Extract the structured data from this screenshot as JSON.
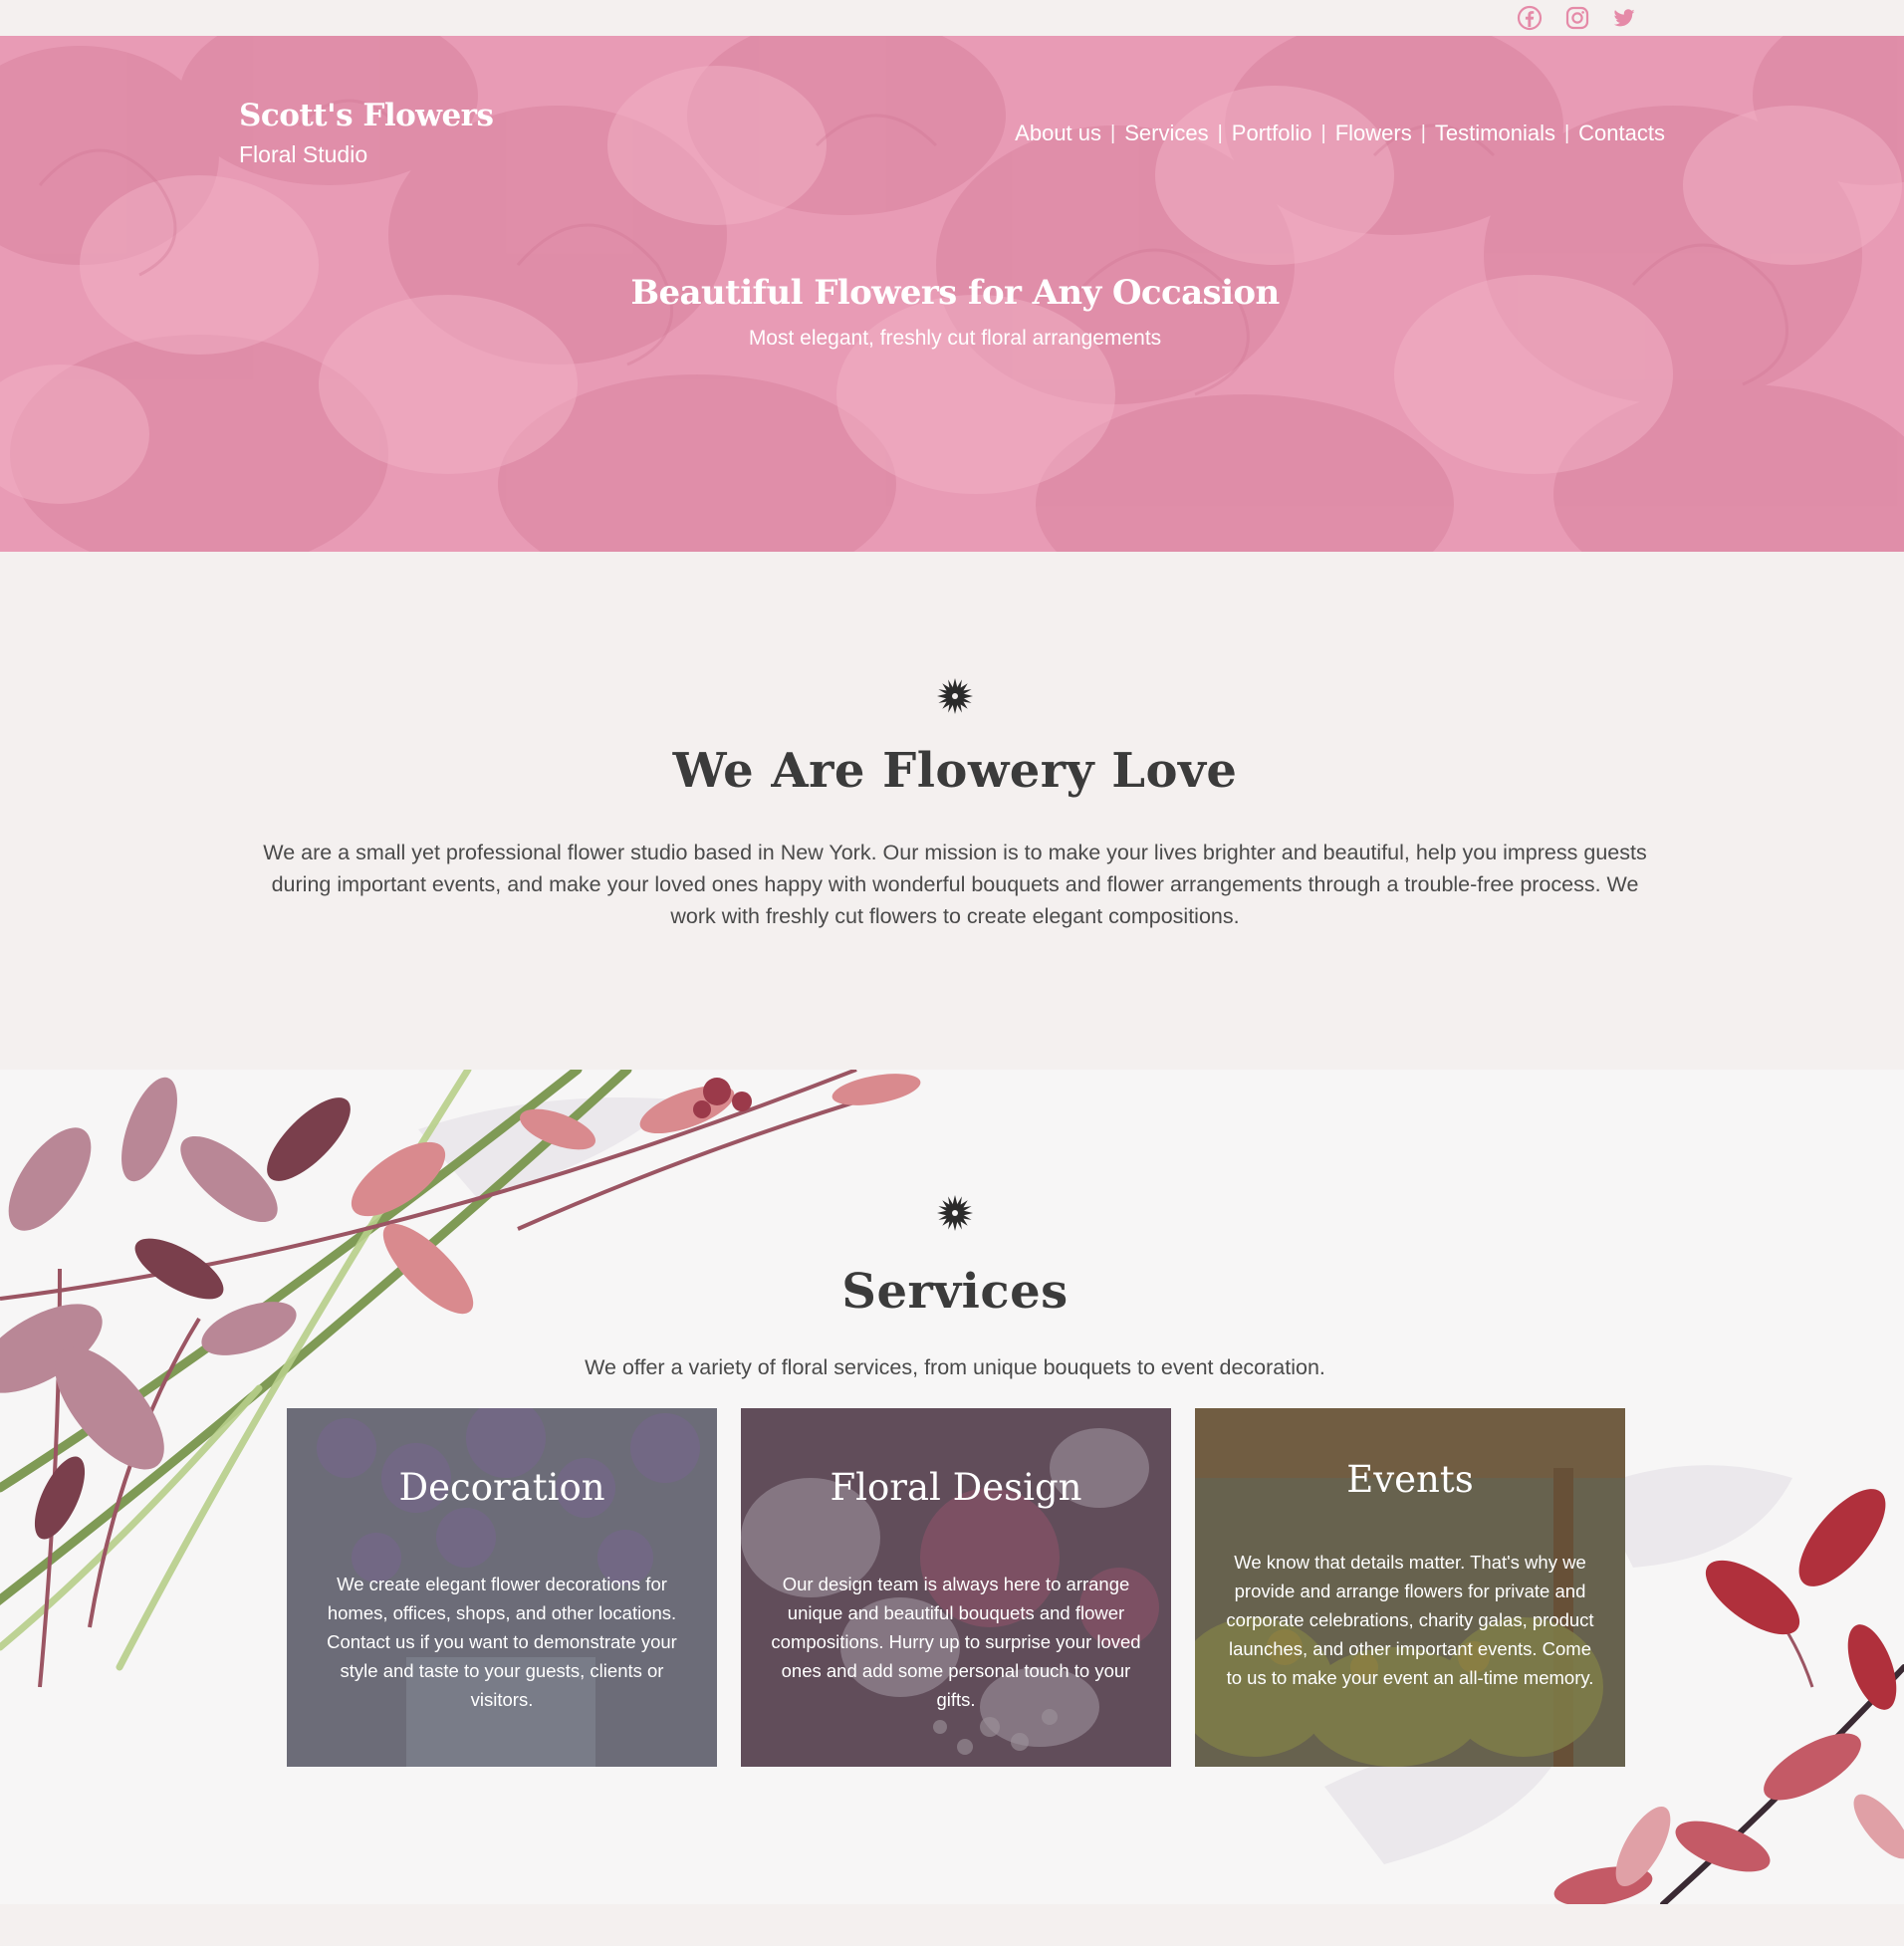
{
  "social": {
    "icons": [
      "facebook-icon",
      "instagram-icon",
      "twitter-icon"
    ],
    "color": "#e58aa8"
  },
  "header": {
    "brand_title": "Scott's Flowers",
    "brand_subtitle": "Floral Studio",
    "nav": [
      "About us",
      "Services",
      "Portfolio",
      "Flowers",
      "Testimonials",
      "Contacts"
    ],
    "separator": "|"
  },
  "hero": {
    "title": "Beautiful Flowers for Any Occasion",
    "subtitle": "Most elegant, freshly cut floral arrangements",
    "overlay_color": "#e79ab4"
  },
  "about": {
    "icon": "flower-icon",
    "title": "We Are Flowery Love",
    "text": "We are a small yet professional flower studio based in New York. Our mission is to make your lives brighter and beautiful, help you impress guests during important events, and make your loved ones happy with wonderful bouquets and flower arrangements through a trouble-free process. We work with freshly cut flowers to create elegant compositions."
  },
  "services": {
    "icon": "flower-icon",
    "title": "Services",
    "subtitle": "We offer a variety of floral services, from unique bouquets to event decoration.",
    "cards": [
      {
        "title": "Decoration",
        "text": "We create elegant flower decorations for homes, offices, shops, and other locations. Contact us if you want to demonstrate your style and taste to your guests, clients or visitors."
      },
      {
        "title": "Floral Design",
        "text": "Our design team is always here to arrange unique and beautiful bouquets and flower compositions. Hurry up to surprise your loved ones and add some personal touch to your gifts."
      },
      {
        "title": "Events",
        "text": "We know that details matter. That's why we provide and arrange flowers for private and corporate celebrations, charity galas, product launches, and other important events. Come to us to make your event an all-time memory."
      }
    ]
  }
}
